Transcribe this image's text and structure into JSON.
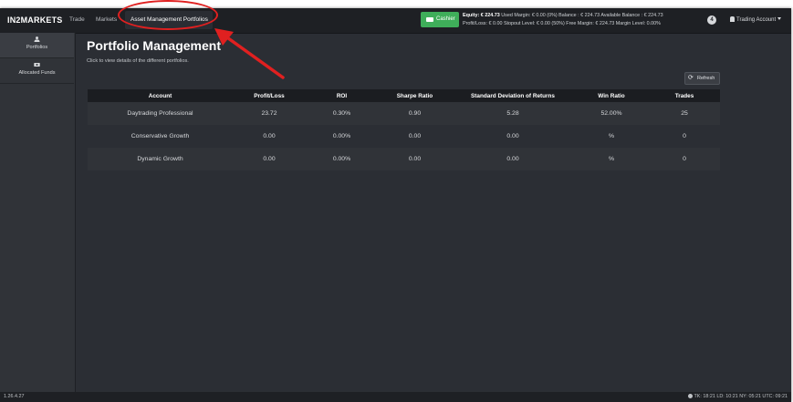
{
  "app": {
    "logo": "IN2MARKETS",
    "nav": [
      "Trade",
      "Markets",
      "Asset Management Portfolios"
    ],
    "cashier_label": "Cashier",
    "account_info": {
      "line1_label": "Equity:",
      "line1_value": "€ 224.73",
      "line1_rest": "Used Margin: € 0.00 (0%) Balance : € 224.73 Available Balance : € 224.73",
      "line2": "Profit/Loss: € 0.00 Stopout Level: € 0.00 (50%) Free Margin: € 224.73 Margin Level: 0.00%"
    },
    "notification_count": "4",
    "user_menu_label": "Trading Account"
  },
  "sidebar": {
    "items": [
      {
        "label": "Portfolios",
        "icon": "user-icon"
      },
      {
        "label": "Allocated Funds",
        "icon": "money-icon"
      }
    ]
  },
  "main": {
    "title": "Portfolio Management",
    "subtitle": "Click to view details of the different portfolios.",
    "refresh_label": "Refresh",
    "table": {
      "headers": [
        "Account",
        "Profit/Loss",
        "ROI",
        "Sharpe Ratio",
        "Standard Deviation of Returns",
        "Win Ratio",
        "Trades"
      ],
      "rows": [
        [
          "Daytrading Professional",
          "23.72",
          "0.30%",
          "0.90",
          "5.28",
          "52.00%",
          "25"
        ],
        [
          "Conservative Growth",
          "0.00",
          "0.00%",
          "0.00",
          "0.00",
          "%",
          "0"
        ],
        [
          "Dynamic Growth",
          "0.00",
          "0.00%",
          "0.00",
          "0.00",
          "%",
          "0"
        ]
      ]
    }
  },
  "status_bar": {
    "version": "1.26.4.27",
    "clock": "TK: 18:21 LD: 10:21 NY: 05:21 UTC: 09:21"
  },
  "colors": {
    "accent_green": "#3fae5a",
    "annotation_red": "#e02020",
    "background": "#2b2e34"
  }
}
